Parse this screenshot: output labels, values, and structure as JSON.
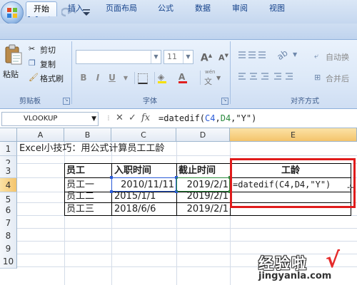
{
  "quick_access": {
    "office_button_icon": "office-logo-icon",
    "icons": [
      "save-icon",
      "undo-icon",
      "redo-icon",
      "customize-dropdown-icon"
    ]
  },
  "ribbon_tabs": [
    "开始",
    "插入",
    "页面布局",
    "公式",
    "数据",
    "审阅",
    "视图"
  ],
  "active_tab": "开始",
  "clipboard": {
    "paste_label": "粘贴",
    "cut_label": "剪切",
    "copy_label": "复制",
    "format_painter_label": "格式刷",
    "group_label": "剪贴板"
  },
  "font_group": {
    "group_label": "字体",
    "font_name": "",
    "font_size": "11",
    "grow_font_label": "A",
    "shrink_font_label": "A",
    "bold_label": "B",
    "italic_label": "I",
    "underline_label": "U",
    "phonetic_label": "wén"
  },
  "alignment_group": {
    "group_label": "对齐方式",
    "wrap_text_label": "自动换",
    "merge_label": "合并后"
  },
  "formula_bar": {
    "name_box": "VLOOKUP",
    "cancel_label": "✕",
    "enter_label": "✓",
    "fx_label": "fx",
    "formula_parts": [
      "=datedif(",
      "C4",
      ",",
      "D4",
      ",\"Y\")"
    ]
  },
  "columns": [
    "A",
    "B",
    "C",
    "D",
    "E"
  ],
  "rows": [
    "1",
    "2",
    "3",
    "4",
    "5",
    "6",
    "7",
    "8",
    "9",
    "10"
  ],
  "sheet": {
    "title": "Excel小技巧：用公式计算员工工龄",
    "headers": {
      "employee": "员工",
      "hire_date": "入职时间",
      "end_date": "截止时间",
      "seniority": "工龄"
    },
    "employees": [
      {
        "name": "员工一",
        "hire_date": "2010/11/11",
        "end_date": "2019/2/1"
      },
      {
        "name": "员工二",
        "hire_date": "2015/1/1",
        "end_date": "2019/2/1"
      },
      {
        "name": "员工三",
        "hire_date": "2018/6/6",
        "end_date": "2019/2/1"
      }
    ],
    "e4_formula": "=datedif(C4,D4,\"Y\")"
  },
  "colors": {
    "ref_c4": "#2a5bd7",
    "ref_d4": "#2b8a3e",
    "highlight_box": "#e01b1b",
    "watermark_check": "#e52b2b"
  },
  "watermark": {
    "main": "经验啦",
    "url": "jingyanla.com"
  }
}
